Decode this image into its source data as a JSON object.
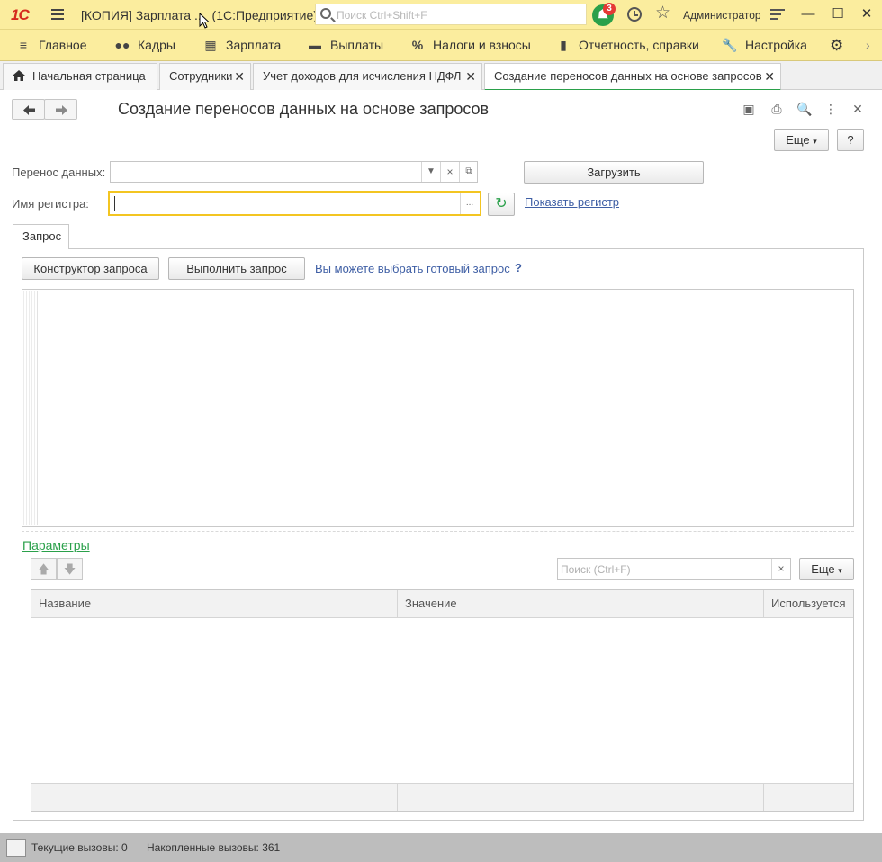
{
  "titlebar": {
    "logo": "1С",
    "title": "[КОПИЯ] Зарплата ...",
    "subtitle": "(1С:Предприятие)",
    "search_placeholder": "Поиск Ctrl+Shift+F",
    "notifications_count": "3",
    "user": "Администратор",
    "minimize": "—",
    "maximize": "☐",
    "close": "✕"
  },
  "sections": {
    "items": [
      {
        "label": "Главное",
        "icon": "menu-icon"
      },
      {
        "label": "Кадры",
        "icon": "people-icon"
      },
      {
        "label": "Зарплата",
        "icon": "calculator-icon"
      },
      {
        "label": "Выплаты",
        "icon": "wallet-icon"
      },
      {
        "label": "Налоги и взносы",
        "icon": "percent-icon"
      },
      {
        "label": "Отчетность, справки",
        "icon": "report-icon"
      },
      {
        "label": "Настройка",
        "icon": "wrench-icon"
      }
    ]
  },
  "tabs": [
    {
      "label": "Начальная страница",
      "closable": false
    },
    {
      "label": "Сотрудники",
      "closable": true
    },
    {
      "label": "Учет доходов для исчисления НДФЛ",
      "closable": true
    },
    {
      "label": "Создание переносов данных на основе запросов",
      "closable": true,
      "active": true
    }
  ],
  "form": {
    "title": "Создание переносов данных на основе запросов",
    "more_label": "Еще",
    "help_label": "?",
    "transfer_label": "Перенос данных:",
    "transfer_value": "",
    "load_button": "Загрузить",
    "register_label": "Имя регистра:",
    "register_value": "",
    "show_register_link": "Показать регистр",
    "query_tab": "Запрос",
    "query_builder_button": "Конструктор запроса",
    "execute_button": "Выполнить запрос",
    "ready_query_link": "Вы можете выбрать готовый запрос",
    "help_q": "?",
    "query_text": "",
    "params_link": "Параметры",
    "params_search_placeholder": "Поиск (Ctrl+F)",
    "params_more": "Еще",
    "columns": [
      "Название",
      "Значение",
      "Используется"
    ]
  },
  "status": {
    "current_calls_label": "Текущие вызовы:",
    "current_calls": "0",
    "accumulated_label": "Накопленные вызовы:",
    "accumulated": "361"
  }
}
